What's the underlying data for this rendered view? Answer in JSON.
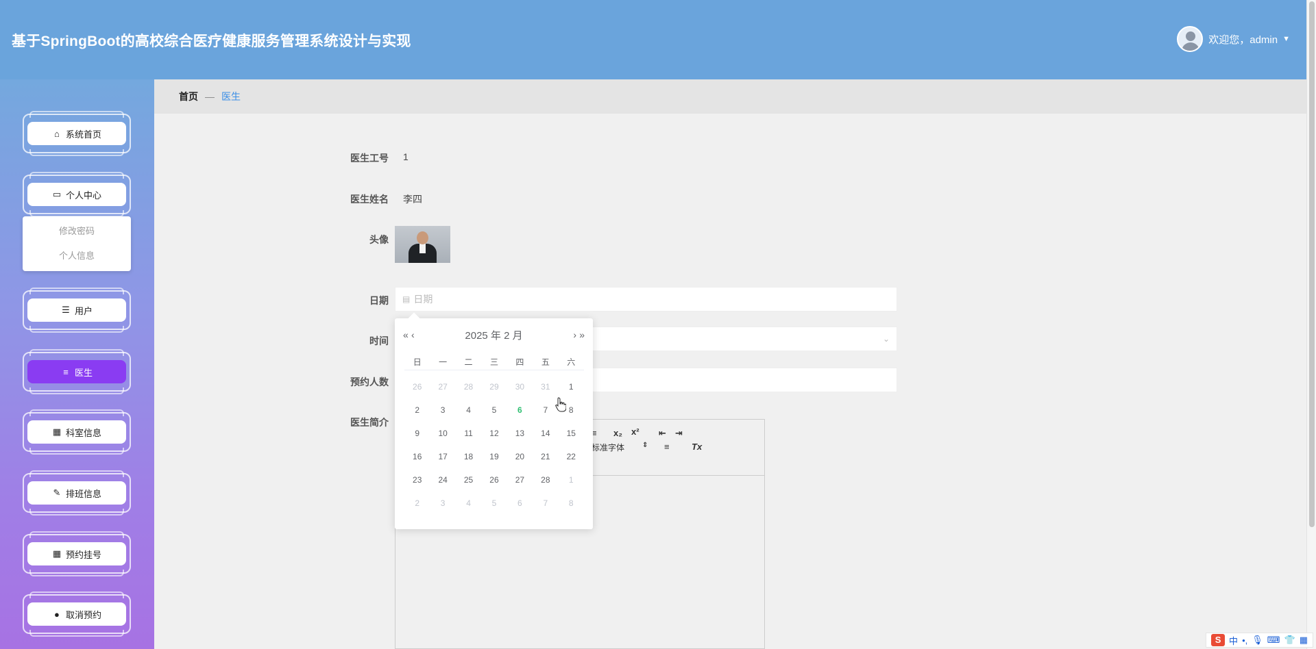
{
  "header": {
    "title": "基于SpringBoot的高校综合医疗健康服务管理系统设计与实现",
    "welcome": "欢迎您，admin"
  },
  "sidebar": {
    "items": [
      {
        "label": "系统首页",
        "icon": "home-icon"
      },
      {
        "label": "个人中心",
        "icon": "wallet-icon"
      },
      {
        "label": "用户",
        "icon": "sliders-icon"
      },
      {
        "label": "医生",
        "icon": "list-icon"
      },
      {
        "label": "科室信息",
        "icon": "grid-icon"
      },
      {
        "label": "排班信息",
        "icon": "clipboard-icon"
      },
      {
        "label": "预约挂号",
        "icon": "grid-icon"
      },
      {
        "label": "取消预约",
        "icon": "location-icon"
      }
    ],
    "submenu": [
      "修改密码",
      "个人信息"
    ],
    "active": "医生",
    "accent_color": "#8a3cf2"
  },
  "breadcrumb": {
    "home": "首页",
    "sep": "—",
    "current": "医生"
  },
  "form": {
    "doctor_id_label": "医生工号",
    "doctor_id": "1",
    "doctor_name_label": "医生姓名",
    "doctor_name": "李四",
    "avatar_label": "头像",
    "date_label": "日期",
    "date_placeholder": "日期",
    "time_label": "时间",
    "count_label": "预约人数",
    "intro_label": "医生简介"
  },
  "editor": {
    "font_select": "标准字体",
    "subscript": "x₂",
    "superscript": "x²",
    "clear_format": "Tx"
  },
  "datepicker": {
    "header": "2025 年  2 月",
    "prev_year": "«",
    "prev_month": "‹",
    "next_month": "›",
    "next_year": "»",
    "weekdays": [
      "日",
      "一",
      "二",
      "三",
      "四",
      "五",
      "六"
    ],
    "weeks": [
      [
        "26",
        "27",
        "28",
        "29",
        "30",
        "31",
        "1"
      ],
      [
        "2",
        "3",
        "4",
        "5",
        "6",
        "7",
        "8"
      ],
      [
        "9",
        "10",
        "11",
        "12",
        "13",
        "14",
        "15"
      ],
      [
        "16",
        "17",
        "18",
        "19",
        "20",
        "21",
        "22"
      ],
      [
        "23",
        "24",
        "25",
        "26",
        "27",
        "28",
        "1"
      ],
      [
        "2",
        "3",
        "4",
        "5",
        "6",
        "7",
        "8"
      ]
    ],
    "today": "6",
    "today_color": "#2fbf71"
  },
  "ime": {
    "lang": "中",
    "punct": "•,"
  }
}
